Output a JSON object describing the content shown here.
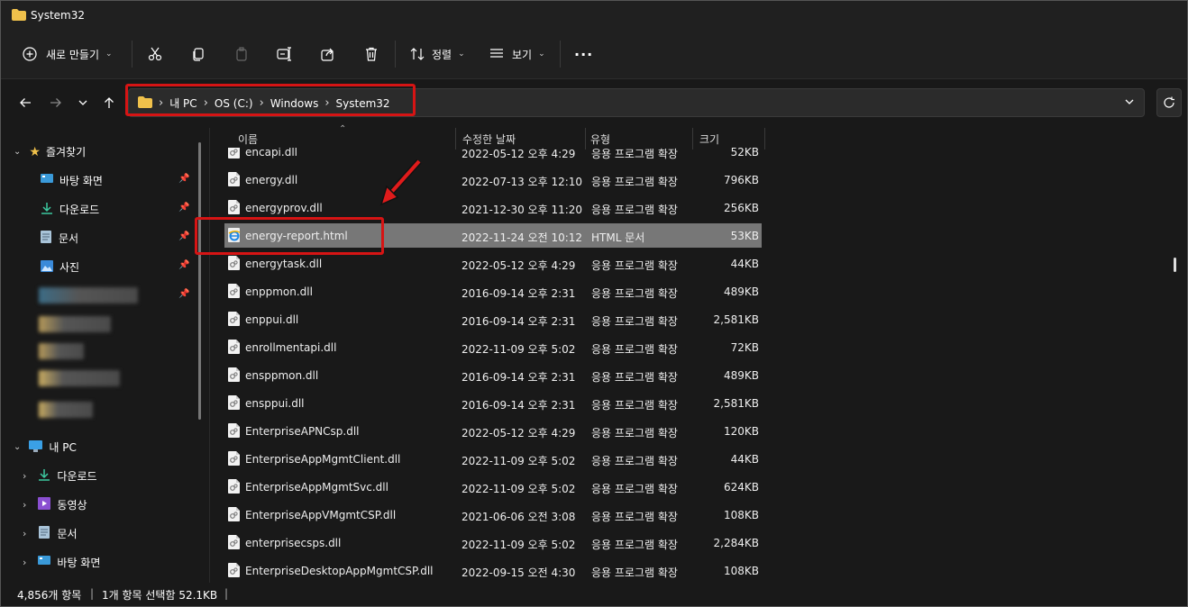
{
  "window": {
    "title": "System32"
  },
  "toolbar": {
    "new_label": "새로 만들기",
    "sort_label": "정렬",
    "view_label": "보기",
    "more_label": "···"
  },
  "address": {
    "crumbs": [
      "내 PC",
      "OS (C:)",
      "Windows",
      "System32"
    ]
  },
  "sidebar": {
    "favorites": "즐겨찾기",
    "quick": [
      {
        "label": "바탕 화면",
        "icon": "desktop-icon"
      },
      {
        "label": "다운로드",
        "icon": "download-icon"
      },
      {
        "label": "문서",
        "icon": "document-icon"
      },
      {
        "label": "사진",
        "icon": "pictures-icon"
      }
    ],
    "pc": "내 PC",
    "pc_items": [
      {
        "label": "다운로드",
        "icon": "download-icon"
      },
      {
        "label": "동영상",
        "icon": "video-icon"
      },
      {
        "label": "문서",
        "icon": "document-icon"
      },
      {
        "label": "바탕 화면",
        "icon": "desktop-icon"
      }
    ]
  },
  "columns": {
    "name": "이름",
    "date": "수정한 날짜",
    "type": "유형",
    "size": "크기"
  },
  "files": [
    {
      "name": "encapi.dll",
      "date": "2022-05-12 오후 4:29",
      "type": "응용 프로그램 확장",
      "size": "52KB"
    },
    {
      "name": "energy.dll",
      "date": "2022-07-13 오후 12:10",
      "type": "응용 프로그램 확장",
      "size": "796KB"
    },
    {
      "name": "energyprov.dll",
      "date": "2021-12-30 오후 11:20",
      "type": "응용 프로그램 확장",
      "size": "256KB"
    },
    {
      "name": "energy-report.html",
      "date": "2022-11-24 오전 10:12",
      "type": "HTML 문서",
      "size": "53KB",
      "selected": true
    },
    {
      "name": "energytask.dll",
      "date": "2022-05-12 오후 4:29",
      "type": "응용 프로그램 확장",
      "size": "44KB"
    },
    {
      "name": "enppmon.dll",
      "date": "2016-09-14 오후 2:31",
      "type": "응용 프로그램 확장",
      "size": "489KB"
    },
    {
      "name": "enppui.dll",
      "date": "2016-09-14 오후 2:31",
      "type": "응용 프로그램 확장",
      "size": "2,581KB"
    },
    {
      "name": "enrollmentapi.dll",
      "date": "2022-11-09 오후 5:02",
      "type": "응용 프로그램 확장",
      "size": "72KB"
    },
    {
      "name": "ensppmon.dll",
      "date": "2016-09-14 오후 2:31",
      "type": "응용 프로그램 확장",
      "size": "489KB"
    },
    {
      "name": "ensppui.dll",
      "date": "2016-09-14 오후 2:31",
      "type": "응용 프로그램 확장",
      "size": "2,581KB"
    },
    {
      "name": "EnterpriseAPNCsp.dll",
      "date": "2022-05-12 오후 4:29",
      "type": "응용 프로그램 확장",
      "size": "120KB"
    },
    {
      "name": "EnterpriseAppMgmtClient.dll",
      "date": "2022-11-09 오후 5:02",
      "type": "응용 프로그램 확장",
      "size": "44KB"
    },
    {
      "name": "EnterpriseAppMgmtSvc.dll",
      "date": "2022-11-09 오후 5:02",
      "type": "응용 프로그램 확장",
      "size": "624KB"
    },
    {
      "name": "EnterpriseAppVMgmtCSP.dll",
      "date": "2021-06-06 오전 3:08",
      "type": "응용 프로그램 확장",
      "size": "108KB"
    },
    {
      "name": "enterprisecsps.dll",
      "date": "2022-11-09 오후 5:02",
      "type": "응용 프로그램 확장",
      "size": "2,284KB"
    },
    {
      "name": "EnterpriseDesktopAppMgmtCSP.dll",
      "date": "2022-09-15 오전 4:30",
      "type": "응용 프로그램 확장",
      "size": "108KB"
    }
  ],
  "status": {
    "count": "4,856개 항목",
    "selection": "1개 항목 선택함 52.1KB"
  },
  "colors": {
    "highlight": "#d61414",
    "folder": "#f0c14b",
    "selected_row": "#777777"
  }
}
